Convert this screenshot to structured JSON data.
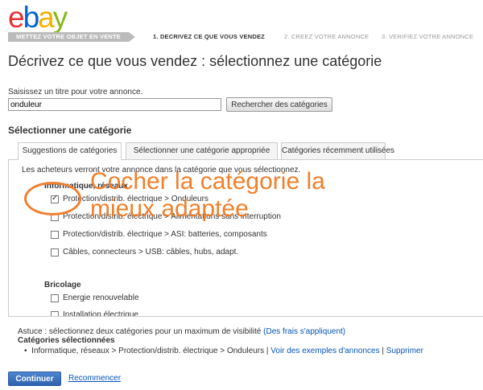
{
  "logo": {
    "e": "e",
    "b": "b",
    "a": "a",
    "y": "y"
  },
  "steps": {
    "main": "METTEZ VOTRE OBJET EN VENTE",
    "step1": "1. DECRIVEZ CE QUE VOUS VENDEZ",
    "step2": "2. CREEZ VOTRE ANNONCE",
    "step3": "3. VERIFIEZ VOTRE ANNONCE"
  },
  "page_title": "Décrivez ce que vous vendez : sélectionnez une catégorie",
  "title_field": {
    "label": "Saisissez un titre pour votre annonce.",
    "value": "onduleur",
    "button": "Rechercher des catégories"
  },
  "section_title": "Sélectionner une catégorie",
  "tabs": [
    {
      "label": "Suggestions de catégories"
    },
    {
      "label": "Sélectionner une catégorie appropriée"
    },
    {
      "label": "Catégories récemment utilisées"
    }
  ],
  "panel": {
    "intro": "Les acheteurs verront votre annonce dans la catégorie que vous sélectionnez.",
    "groups": [
      {
        "title": "Informatique, réseaux",
        "options": [
          {
            "label": "Protection/distrib. électrique > Onduleurs",
            "checked": true
          },
          {
            "label": "Protection/distrib. électrique > Alimentations sans interruption",
            "checked": false
          },
          {
            "label": "Protection/distrib. électrique > ASI: batteries, composants",
            "checked": false
          },
          {
            "label": "Câbles, connecteurs > USB: câbles, hubs, adapt.",
            "checked": false
          }
        ]
      },
      {
        "title": "Bricolage",
        "options": [
          {
            "label": "Energie renouvelable",
            "checked": false
          },
          {
            "label": "Installation électrique",
            "checked": false
          }
        ]
      }
    ]
  },
  "annotation": {
    "line1": "Cocher la catégorie la",
    "line2": "mieux adaptée",
    "color": "#f07a20"
  },
  "tip": {
    "text": "Astuce : sélectionnez deux catégories pour un maximum de visibilité ",
    "link": "(Des frais s'appliquent)"
  },
  "selected": {
    "label": "Catégories sélectionnées",
    "item": "Informatique, réseaux > Protection/distrib. électrique > Onduleurs",
    "examples_link": "Voir des exemples d'annonces",
    "delete_link": "Supprimer"
  },
  "actions": {
    "continue": "Continuer",
    "restart": "Recommencer"
  }
}
